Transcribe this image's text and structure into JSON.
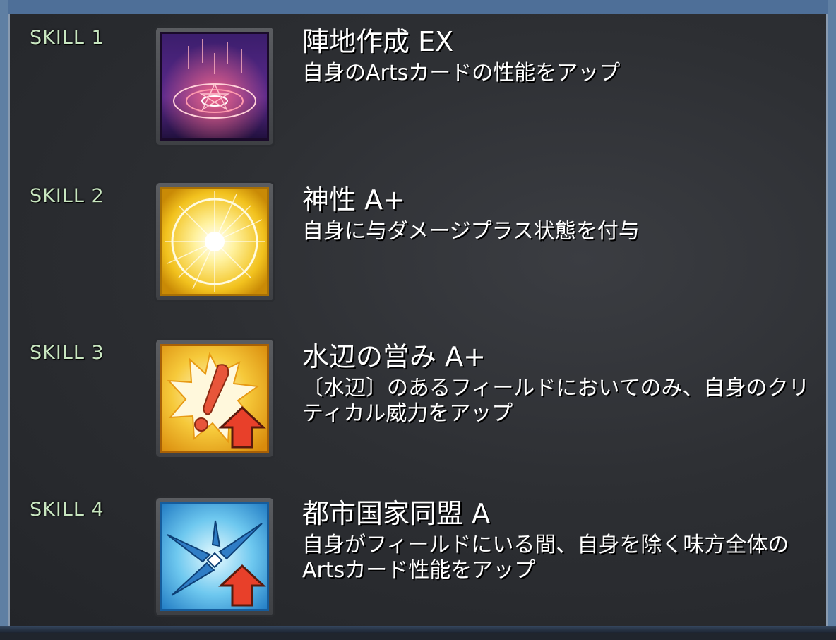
{
  "skills": [
    {
      "label": "SKILL 1",
      "name": "陣地作成 EX",
      "description": "自身のArtsカードの性能をアップ",
      "icon": "magic-circle-icon"
    },
    {
      "label": "SKILL 2",
      "name": "神性 A+",
      "description": "自身に与ダメージプラス状態を付与",
      "icon": "divine-light-icon"
    },
    {
      "label": "SKILL 3",
      "name": "水辺の営み A+",
      "description": "〔水辺〕のあるフィールドにおいてのみ、自身のクリティカル威力をアップ",
      "icon": "critical-up-icon"
    },
    {
      "label": "SKILL 4",
      "name": "都市国家同盟 A",
      "description": "自身がフィールドにいる間、自身を除く味方全体のArtsカード性能をアップ",
      "icon": "arts-up-icon"
    }
  ],
  "colors": {
    "skill_label": "#c8e6c0",
    "text": "#ffffff",
    "panel": "#2d2f33",
    "frame": "#5f7fa3"
  }
}
